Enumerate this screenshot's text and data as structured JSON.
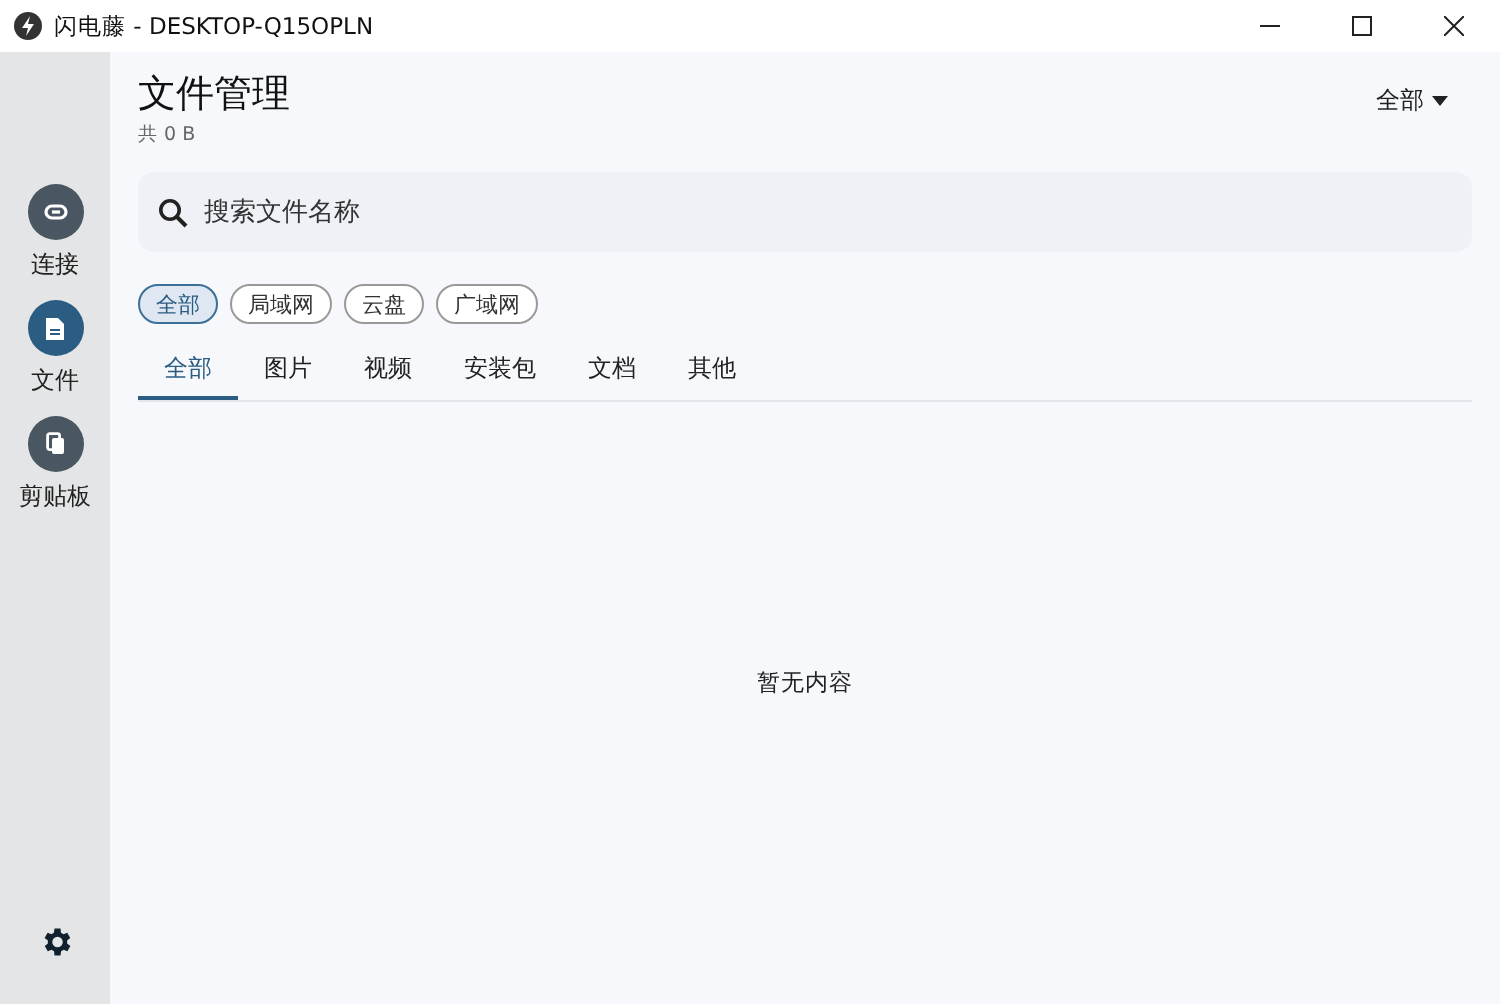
{
  "window": {
    "title": "闪电藤 - DESKTOP-Q15OPLN"
  },
  "sidebar": {
    "items": [
      {
        "label": "连接",
        "kind": "link",
        "selected": false
      },
      {
        "label": "文件",
        "kind": "file",
        "selected": true
      },
      {
        "label": "剪贴板",
        "kind": "clipboard",
        "selected": false
      }
    ]
  },
  "header": {
    "title": "文件管理",
    "subtitle": "共 0 B",
    "dropdown": "全部"
  },
  "search": {
    "placeholder": "搜索文件名称"
  },
  "filters": [
    {
      "label": "全部",
      "selected": true
    },
    {
      "label": "局域网",
      "selected": false
    },
    {
      "label": "云盘",
      "selected": false
    },
    {
      "label": "广域网",
      "selected": false
    }
  ],
  "tabs": [
    {
      "label": "全部",
      "selected": true
    },
    {
      "label": "图片",
      "selected": false
    },
    {
      "label": "视频",
      "selected": false
    },
    {
      "label": "安装包",
      "selected": false
    },
    {
      "label": "文档",
      "selected": false
    },
    {
      "label": "其他",
      "selected": false
    }
  ],
  "empty_message": "暂无内容"
}
